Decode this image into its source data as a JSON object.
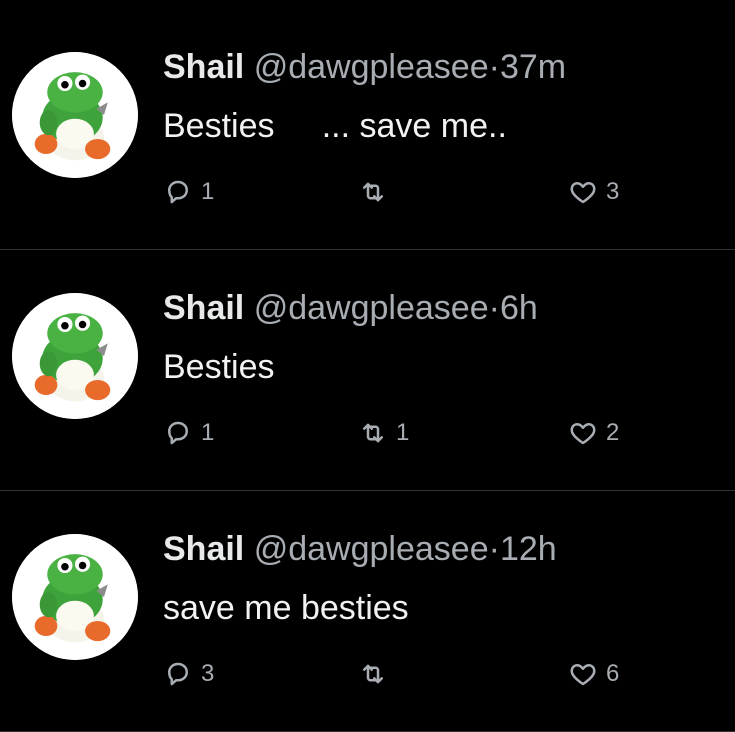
{
  "tweets": [
    {
      "name": "Shail",
      "handle": "@dawgpleasee",
      "separator": "·",
      "time": "37m",
      "text": "Besties     ... save me..",
      "reply_count": "1",
      "retweet_count": "",
      "like_count": "3"
    },
    {
      "name": "Shail",
      "handle": "@dawgpleasee",
      "separator": "·",
      "time": "6h",
      "text": "Besties",
      "reply_count": "1",
      "retweet_count": "1",
      "like_count": "2"
    },
    {
      "name": "Shail",
      "handle": "@dawgpleasee",
      "separator": "·",
      "time": "12h",
      "text": "save me besties",
      "reply_count": "3",
      "retweet_count": "",
      "like_count": "6"
    }
  ],
  "icons": {
    "reply": "reply-icon",
    "retweet": "retweet-icon",
    "like": "heart-icon",
    "avatar": "yoshi-avatar"
  },
  "colors": {
    "background": "#000000",
    "text": "#f2f2f2",
    "secondary": "#a8adb3",
    "divider": "#2f3336"
  }
}
